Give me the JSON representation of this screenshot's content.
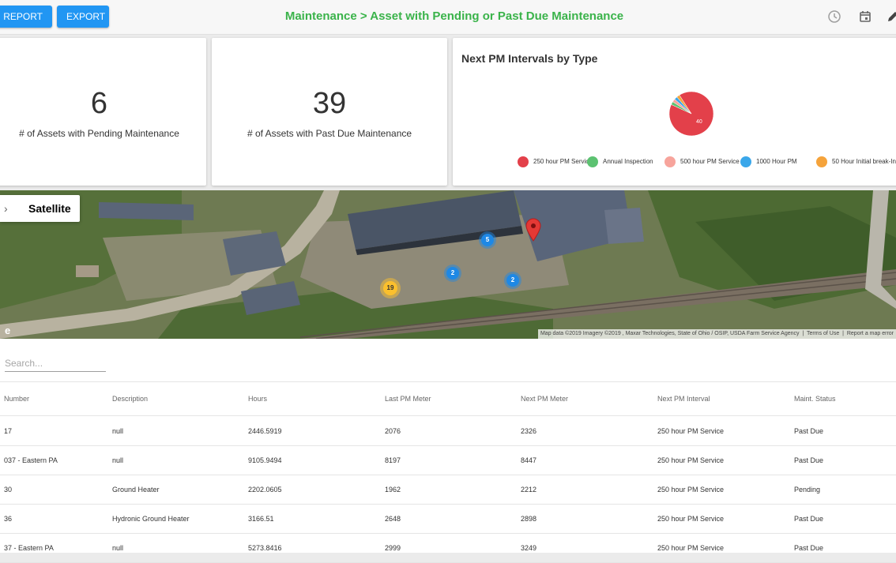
{
  "toolbar": {
    "report_label": "REPORT",
    "export_label": "EXPORT",
    "title": "Maintenance > Asset with Pending or Past Due Maintenance",
    "icons": [
      "clock-icon",
      "calendar-icon",
      "edit-icon"
    ]
  },
  "kpis": [
    {
      "value": "6",
      "label": "# of Assets with Pending Maintenance"
    },
    {
      "value": "39",
      "label": "# of Assets with Past Due Maintenance"
    }
  ],
  "chart_data": {
    "type": "pie",
    "title": "Next PM Intervals by Type",
    "slice_label": "40",
    "legend": [
      {
        "name": "250 hour PM Service",
        "color": "#e3404a"
      },
      {
        "name": "Annual Inspection",
        "color": "#5cc271"
      },
      {
        "name": "500 hour PM Service",
        "color": "#f7a49c"
      },
      {
        "name": "1000 Hour PM",
        "color": "#3aa7ea"
      },
      {
        "name": "50 Hour Initial break-In",
        "color": "#f5a33b"
      }
    ],
    "values": [
      40,
      1,
      1,
      1,
      1
    ]
  },
  "map": {
    "type_button": "Satellite",
    "attribution": "Map data ©2019 Imagery ©2019 , Maxar Technologies, State of Ohio / OSIP, USDA Farm Service Agency",
    "terms": "Terms of Use",
    "report": "Report a map error",
    "clusters": [
      "5",
      "2",
      "2",
      "19"
    ],
    "edge_letter": "e"
  },
  "table": {
    "search_placeholder": "Search...",
    "columns": [
      "Number",
      "Description",
      "Hours",
      "Last PM Meter",
      "Next PM Meter",
      "Next PM Interval",
      "Maint. Status"
    ],
    "rows": [
      [
        "17",
        "null",
        "2446.5919",
        "2076",
        "2326",
        "250 hour PM Service",
        "Past Due"
      ],
      [
        "037 - Eastern PA",
        "null",
        "9105.9494",
        "8197",
        "8447",
        "250 hour PM Service",
        "Past Due"
      ],
      [
        "30",
        "Ground Heater",
        "2202.0605",
        "1962",
        "2212",
        "250 hour PM Service",
        "Pending"
      ],
      [
        "36",
        "Hydronic Ground Heater",
        "3166.51",
        "2648",
        "2898",
        "250 hour PM Service",
        "Past Due"
      ],
      [
        "37 - Eastern PA",
        "null",
        "5273.8416",
        "2999",
        "3249",
        "250 hour PM Service",
        "Past Due"
      ]
    ]
  }
}
